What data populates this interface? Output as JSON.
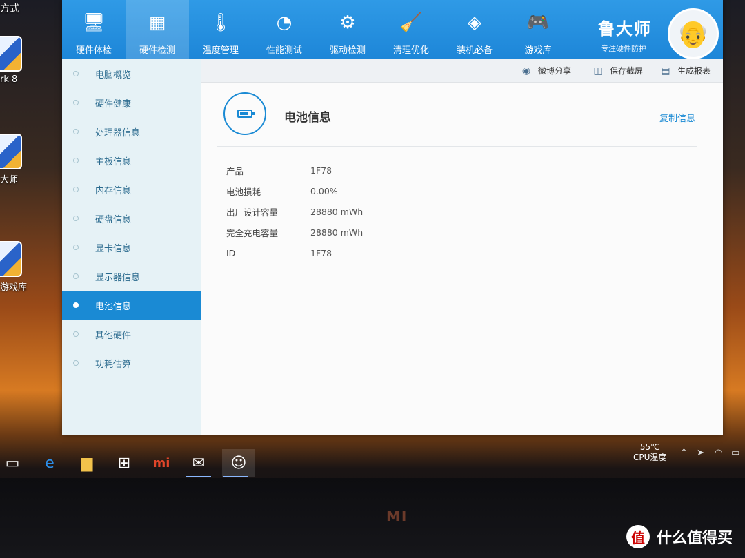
{
  "desktop": {
    "top_partial_label": "方式",
    "icons": [
      {
        "label": "rk 8",
        "icon": "app-icon"
      },
      {
        "label": "大师",
        "icon": "ludashi-icon"
      },
      {
        "label": "游戏库",
        "icon": "gamelib-icon"
      }
    ]
  },
  "app": {
    "nav": [
      {
        "label": "硬件体检",
        "icon": "monitor-icon",
        "glyph": "🖥"
      },
      {
        "label": "硬件检测",
        "icon": "circuit-board-icon",
        "glyph": "▦"
      },
      {
        "label": "温度管理",
        "icon": "thermometer-icon",
        "glyph": "🌡"
      },
      {
        "label": "性能测试",
        "icon": "gauge-icon",
        "glyph": "◔"
      },
      {
        "label": "驱动检测",
        "icon": "gear-icon",
        "glyph": "⚙"
      },
      {
        "label": "清理优化",
        "icon": "broom-icon",
        "glyph": "🧹"
      },
      {
        "label": "装机必备",
        "icon": "cube-icon",
        "glyph": "◈"
      },
      {
        "label": "游戏库",
        "icon": "gamepad-icon",
        "glyph": "🎮"
      }
    ],
    "brand": {
      "name": "鲁大师",
      "subtitle": "专注硬件防护",
      "avatar_glyph": "👴"
    },
    "sidebar": [
      {
        "label": "电脑概览"
      },
      {
        "label": "硬件健康"
      },
      {
        "label": "处理器信息"
      },
      {
        "label": "主板信息"
      },
      {
        "label": "内存信息"
      },
      {
        "label": "硬盘信息"
      },
      {
        "label": "显卡信息"
      },
      {
        "label": "显示器信息"
      },
      {
        "label": "电池信息"
      },
      {
        "label": "其他硬件"
      },
      {
        "label": "功耗估算"
      }
    ],
    "toolbar": {
      "share": "微博分享",
      "screenshot": "保存截屏",
      "report": "生成报表"
    },
    "content": {
      "title": "电池信息",
      "copy_link": "复制信息",
      "rows": [
        {
          "key": "产品",
          "value": "1F78"
        },
        {
          "key": "电池损耗",
          "value": "0.00%"
        },
        {
          "key": "出厂设计容量",
          "value": "28880 mWh"
        },
        {
          "key": "完全充电容量",
          "value": "28880 mWh"
        },
        {
          "key": "ID",
          "value": "1F78"
        }
      ]
    }
  },
  "taskbar": {
    "cpu_temp_value": "55℃",
    "cpu_temp_label": "CPU温度"
  },
  "bezel_logo": "MI",
  "watermark": {
    "badge": "值",
    "text": "什么值得买"
  }
}
